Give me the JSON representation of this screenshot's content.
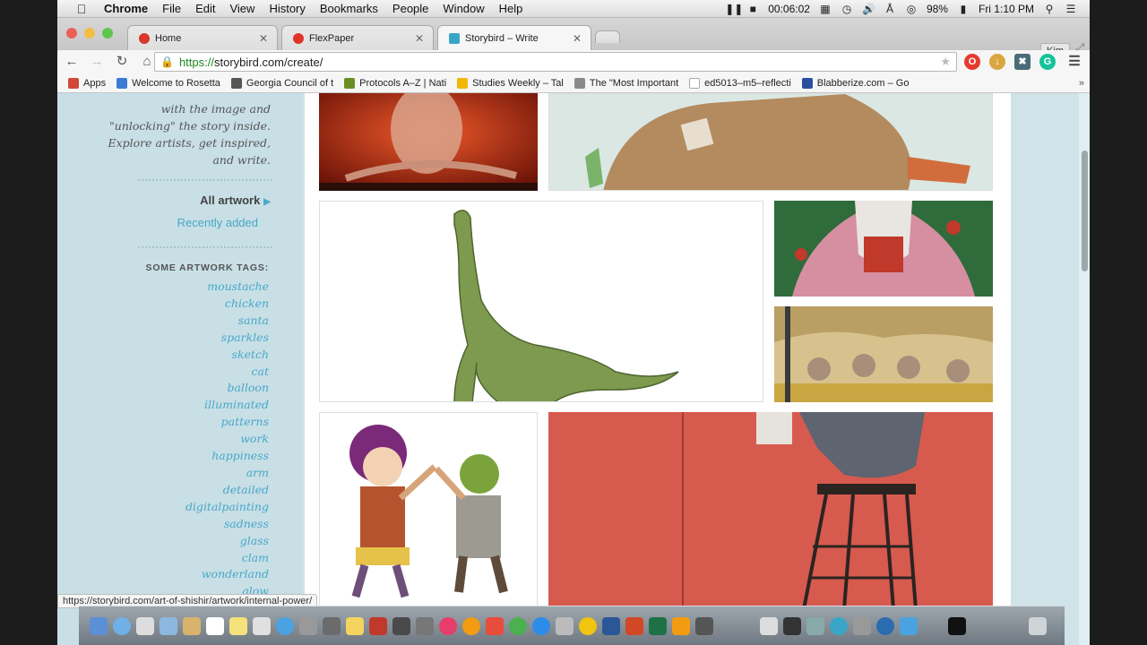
{
  "menubar": {
    "app_name": "Chrome",
    "items": [
      "File",
      "Edit",
      "View",
      "History",
      "Bookmarks",
      "People",
      "Window",
      "Help"
    ],
    "timer": "00:06:02",
    "battery": "98%",
    "clock": "Fri 1:10 PM"
  },
  "tabs": [
    {
      "title": "Home",
      "color": "#d8372b"
    },
    {
      "title": "FlexPaper",
      "color": "#e0342a"
    },
    {
      "title": "Storybird – Write",
      "color": "#3aa6c7"
    }
  ],
  "profile": "Kim",
  "url": {
    "scheme": "https://",
    "host": "storybird.com",
    "path": "/create/"
  },
  "bookmarks": [
    {
      "label": "Apps",
      "color": "#d14836"
    },
    {
      "label": "Welcome to Rosetta",
      "color": "#3b7bd4"
    },
    {
      "label": "Georgia Council of t",
      "color": "#555555"
    },
    {
      "label": "Protocols A–Z | Nati",
      "color": "#6b8e23"
    },
    {
      "label": "Studies Weekly – Tal",
      "color": "#f2b705"
    },
    {
      "label": "The \"Most Important",
      "color": "#8a8a8a"
    },
    {
      "label": "ed5013–m5–reflecti",
      "color": "#dddddd"
    },
    {
      "label": "Blabberize.com – Go",
      "color": "#2a4fa0"
    }
  ],
  "sidebar": {
    "intro": "with the image and \"unlocking\" the story inside. Explore artists, get inspired, and write.",
    "all_artwork": "All artwork",
    "recently_added": "Recently added",
    "tags_heading": "SOME ARTWORK TAGS:",
    "tags": [
      "moustache",
      "chicken",
      "santa",
      "sparkles",
      "sketch",
      "cat",
      "balloon",
      "illuminated",
      "patterns",
      "work",
      "happiness",
      "arm",
      "detailed",
      "digitalpainting",
      "sadness",
      "glass",
      "clam",
      "wonderland",
      "glow"
    ]
  },
  "status_url": "https://storybird.com/art-of-shishir/artwork/internal-power/",
  "colors": {
    "link": "#49a8c8",
    "sidebar_bg": "#c8dfe6"
  }
}
